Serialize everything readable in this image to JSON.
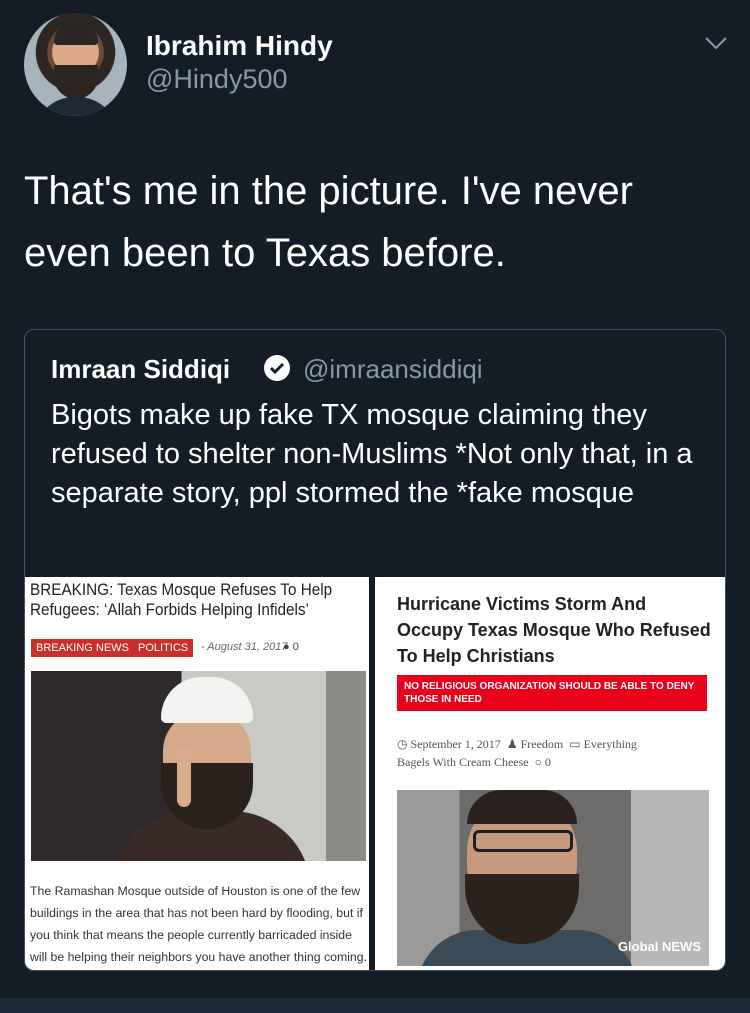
{
  "tweet": {
    "author_name": "Ibrahim Hindy",
    "author_handle": "@Hindy500",
    "text": "That's me in the picture. I've never even been to Texas before."
  },
  "quoted_tweet": {
    "author_name": "Imraan Siddiqi",
    "author_handle": "@imraansiddiqi",
    "text": "Bigots make up fake TX mosque claiming they refused to shelter non-Muslims *Not only that, in a separate story, ppl stormed the *fake mosque",
    "left_article": {
      "headline": "BREAKING: Texas Mosque Refuses To Help Refugees: ‘Allah Forbids Helping Infidels’",
      "tag1": "BREAKING NEWS",
      "tag2": "POLITICS",
      "date": "- August 31, 2017",
      "comments": "0",
      "body": "The Ramashan Mosque outside of Houston is one of the few buildings in the area that has not been hard by flooding, but if you think that means the people currently barricaded inside will be helping their neighbors you have another thing coming."
    },
    "right_article": {
      "headline": "Hurricane Victims Storm And Occupy Texas Mosque Who Refused To Help Christians",
      "banner": "NO RELIGIOUS ORGANIZATION SHOULD BE ABLE TO DENY THOSE IN NEED",
      "meta_date": "September 1, 2017",
      "meta_author": "Freedom",
      "meta_category": "Everything",
      "meta_line2": "Bagels With Cream Cheese",
      "meta_comments": "0",
      "logo": "Global NEWS"
    }
  },
  "colors": {
    "background": "#141d26",
    "secondary_text": "#8899a6",
    "verified": "#ffffff",
    "tag_red": "#c9302c",
    "banner_red": "#e8001c"
  },
  "icons": [
    "chevron-down-icon",
    "verified-badge-icon",
    "comment-bubble-icon",
    "clock-icon",
    "user-icon",
    "folder-icon"
  ]
}
